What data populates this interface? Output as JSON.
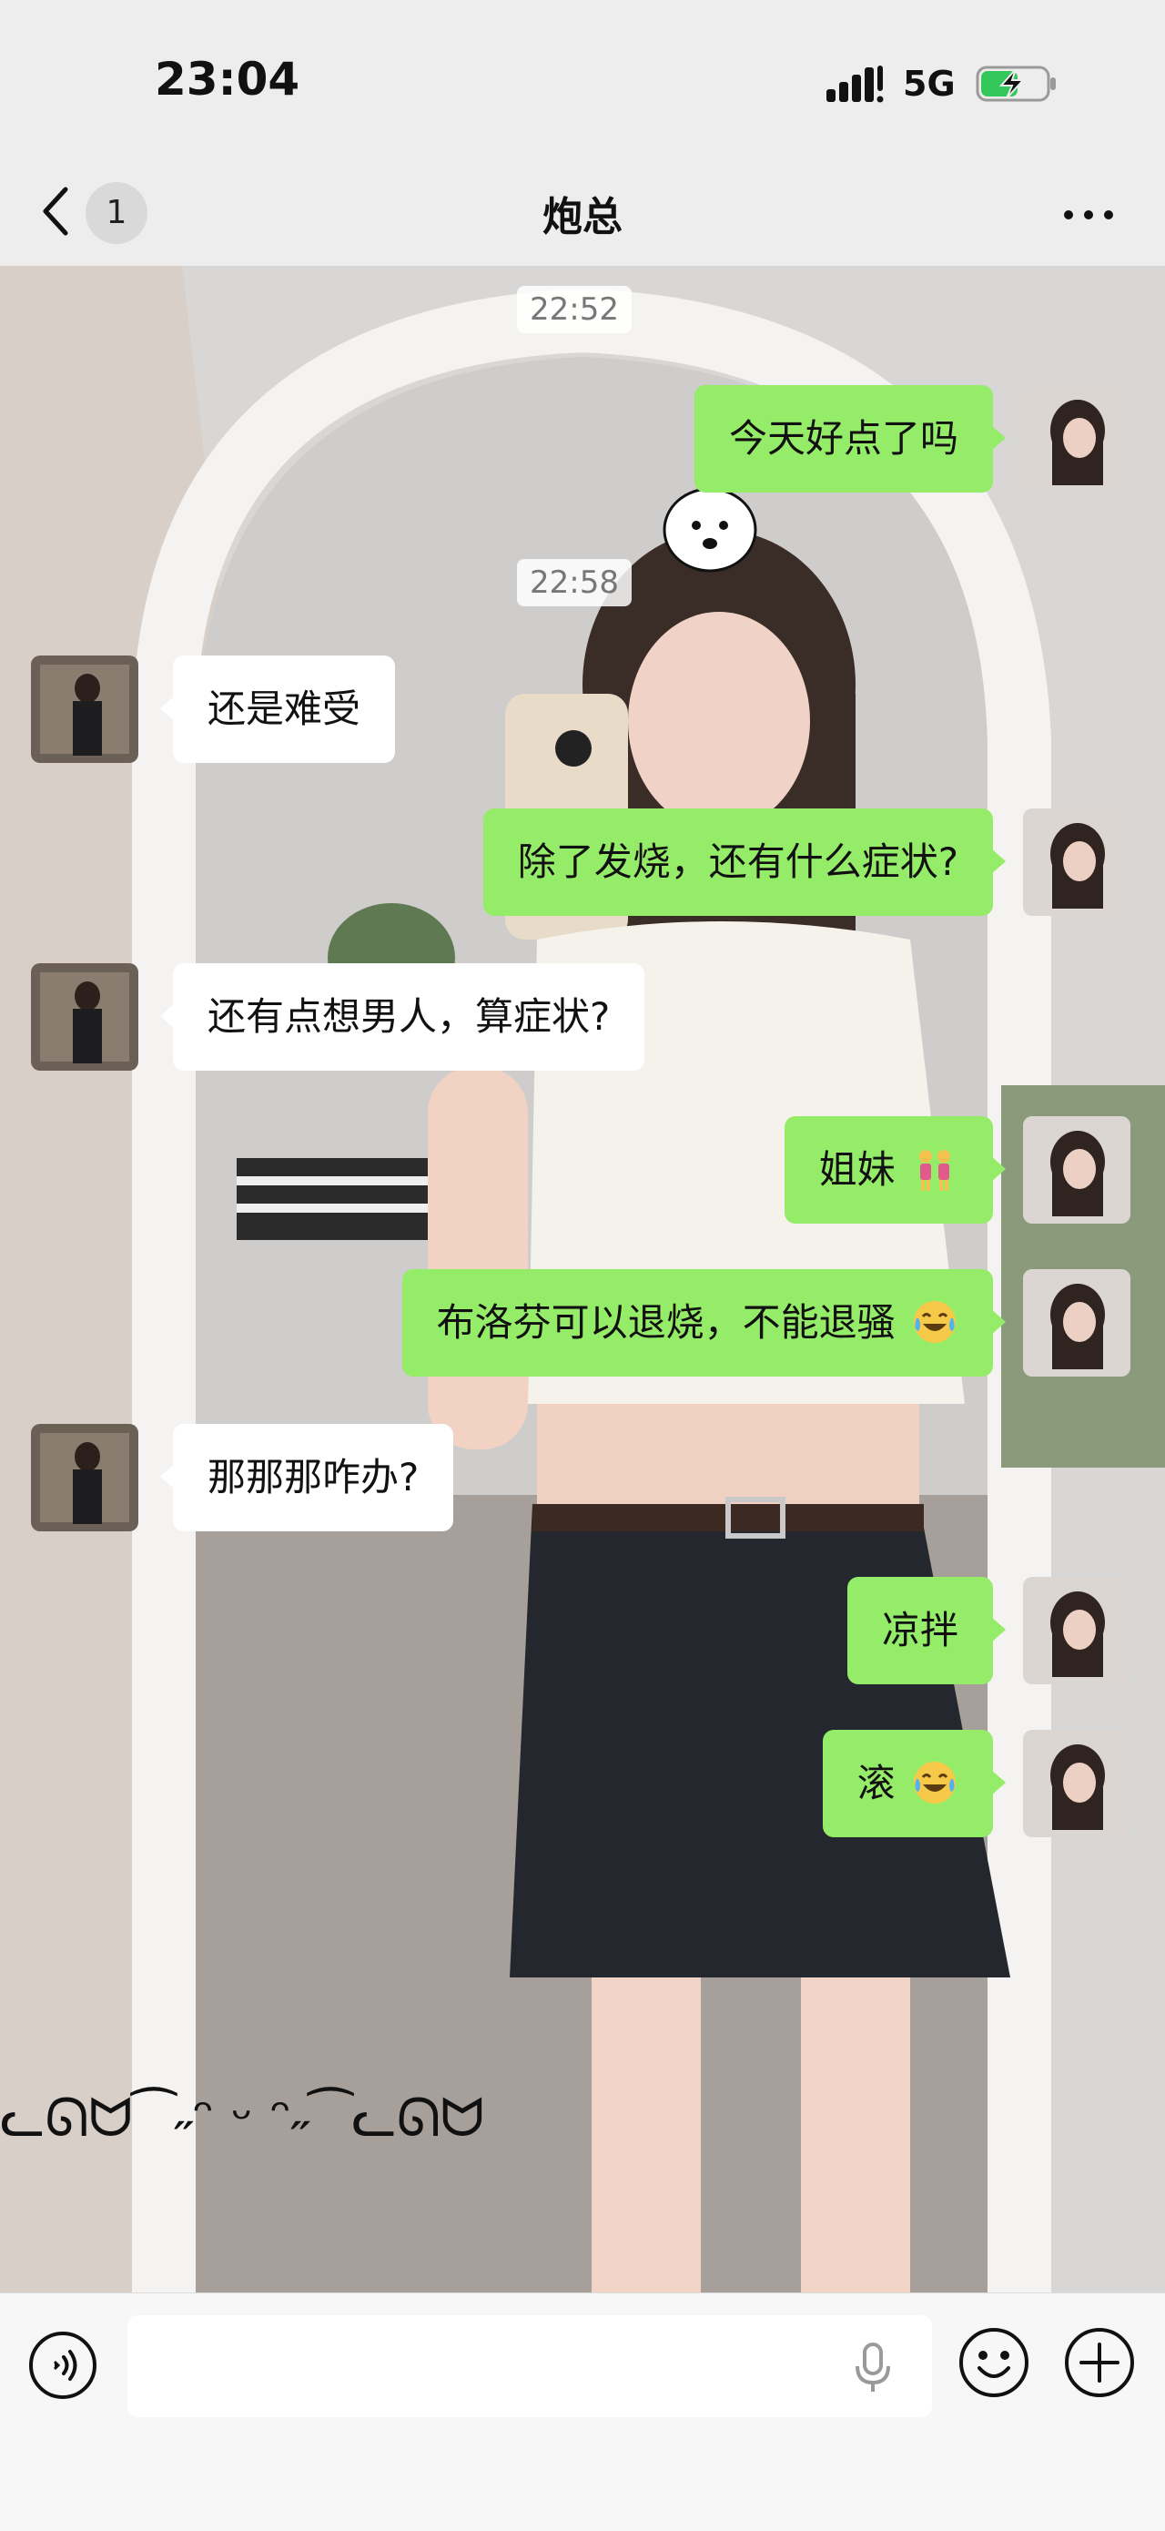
{
  "status_bar": {
    "time": "23:04",
    "network": "5G",
    "signal_icon": "signal-bars-icon",
    "battery_icon": "battery-charging-icon"
  },
  "nav": {
    "back_icon": "chevron-left-icon",
    "unread_count": "1",
    "title": "炮总",
    "more_icon": "ellipsis-icon"
  },
  "chat": {
    "messages": [
      {
        "type": "timestamp",
        "text": "22:52"
      },
      {
        "type": "sent",
        "text": "今天好点了吗"
      },
      {
        "type": "timestamp",
        "text": "22:58"
      },
      {
        "type": "received",
        "text": "还是难受"
      },
      {
        "type": "sent",
        "text": "除了发烧，还有什么症状?"
      },
      {
        "type": "received",
        "text": "还有点想男人，算症状?"
      },
      {
        "type": "sent",
        "text": "姐妹",
        "emoji": "two-women-icon"
      },
      {
        "type": "sent",
        "text": "布洛芬可以退烧，不能退骚",
        "emoji": "laughing-crying-face-icon"
      },
      {
        "type": "received",
        "text": "那那那咋办?"
      },
      {
        "type": "sent",
        "text": "凉拌"
      },
      {
        "type": "sent",
        "text": "滚",
        "emoji": "laughing-crying-face-icon"
      }
    ],
    "background_decoration_text": "ᓚᘏᗢ⁀˶ᵔ ᵕ ᵔ˶⁀ᓚᘏᗢ"
  },
  "input_bar": {
    "text_value": "",
    "placeholder": "",
    "voice_icon": "voice-waves-icon",
    "mic_icon": "microphone-icon",
    "emoji_icon": "smiley-face-icon",
    "plus_icon": "plus-circle-icon"
  },
  "colors": {
    "sent_bubble": "#95ec69",
    "received_bubble": "#ffffff",
    "bar_background": "#ededed"
  }
}
